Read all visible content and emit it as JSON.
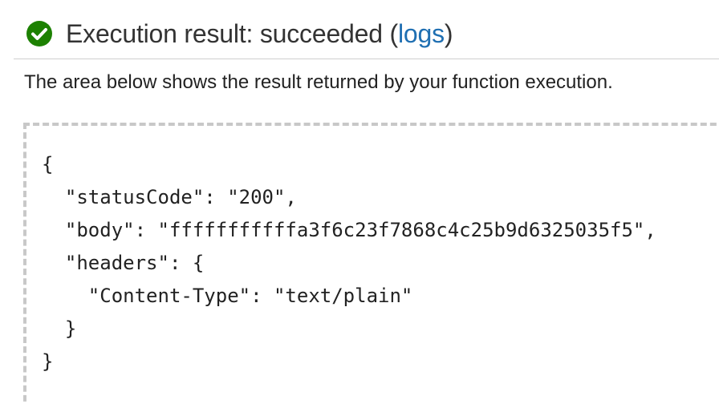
{
  "header": {
    "status_icon": "check-circle-icon",
    "status_color": "#1d8102",
    "title_prefix": "Execution result: succeeded (",
    "logs_link": "logs",
    "title_suffix": ")"
  },
  "description": "The area below shows the result returned by your function execution.",
  "result_json": "{\n  \"statusCode\": \"200\",\n  \"body\": \"fffffffffffa3f6c23f7868c4c25b9d6325035f5\",\n  \"headers\": {\n    \"Content-Type\": \"text/plain\"\n  }\n}"
}
